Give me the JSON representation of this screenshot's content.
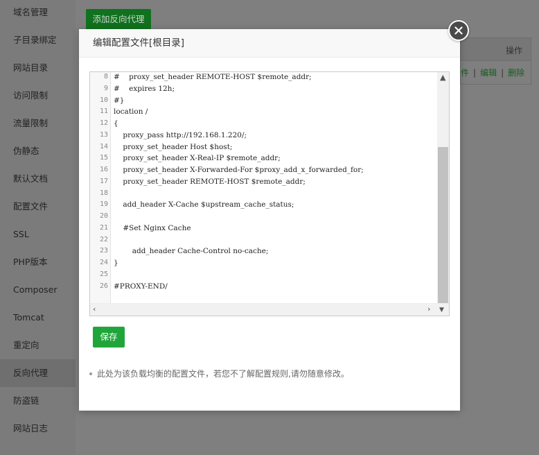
{
  "sidebar": {
    "items": [
      {
        "label": "域名管理",
        "active": false
      },
      {
        "label": "子目录绑定",
        "active": false
      },
      {
        "label": "网站目录",
        "active": false
      },
      {
        "label": "访问限制",
        "active": false
      },
      {
        "label": "流量限制",
        "active": false
      },
      {
        "label": "伪静态",
        "active": false
      },
      {
        "label": "默认文档",
        "active": false
      },
      {
        "label": "配置文件",
        "active": false
      },
      {
        "label": "SSL",
        "active": false
      },
      {
        "label": "PHP版本",
        "active": false
      },
      {
        "label": "Composer",
        "active": false
      },
      {
        "label": "Tomcat",
        "active": false
      },
      {
        "label": "重定向",
        "active": false
      },
      {
        "label": "反向代理",
        "active": true
      },
      {
        "label": "防盗链",
        "active": false
      },
      {
        "label": "网站日志",
        "active": false
      }
    ]
  },
  "background": {
    "add_button": "添加反向代理",
    "operation_header": "操作",
    "row_actions": {
      "file_partial": "件",
      "edit": "编辑",
      "delete": "删除"
    }
  },
  "modal": {
    "title": "编辑配置文件[根目录]",
    "close_icon": "close-icon",
    "save_button": "保存",
    "note": "此处为该负载均衡的配置文件，若您不了解配置规则,请勿随意修改。"
  },
  "editor": {
    "lines": [
      {
        "n": "8",
        "text": "#    proxy_set_header REMOTE-HOST $remote_addr;"
      },
      {
        "n": "9",
        "text": "#    expires 12h;"
      },
      {
        "n": "10",
        "text": "#}"
      },
      {
        "n": "11",
        "text": "location /"
      },
      {
        "n": "12",
        "text": "{"
      },
      {
        "n": "13",
        "text": "    proxy_pass http://192.168.1.220/;"
      },
      {
        "n": "14",
        "text": "    proxy_set_header Host $host;"
      },
      {
        "n": "15",
        "text": "    proxy_set_header X-Real-IP $remote_addr;"
      },
      {
        "n": "16",
        "text": "    proxy_set_header X-Forwarded-For $proxy_add_x_forwarded_for;"
      },
      {
        "n": "17",
        "text": "    proxy_set_header REMOTE-HOST $remote_addr;"
      },
      {
        "n": "18",
        "text": ""
      },
      {
        "n": "19",
        "text": "    add_header X-Cache $upstream_cache_status;"
      },
      {
        "n": "20",
        "text": ""
      },
      {
        "n": "21",
        "text": "    #Set Nginx Cache"
      },
      {
        "n": "22",
        "text": ""
      },
      {
        "n": "23",
        "text": "        add_header Cache-Control no-cache;"
      },
      {
        "n": "24",
        "text": "}"
      },
      {
        "n": "25",
        "text": ""
      },
      {
        "n": "26",
        "text": "#PROXY-END/"
      }
    ]
  },
  "colors": {
    "accent": "#20a53a",
    "overlay": "#7f7f7f"
  }
}
